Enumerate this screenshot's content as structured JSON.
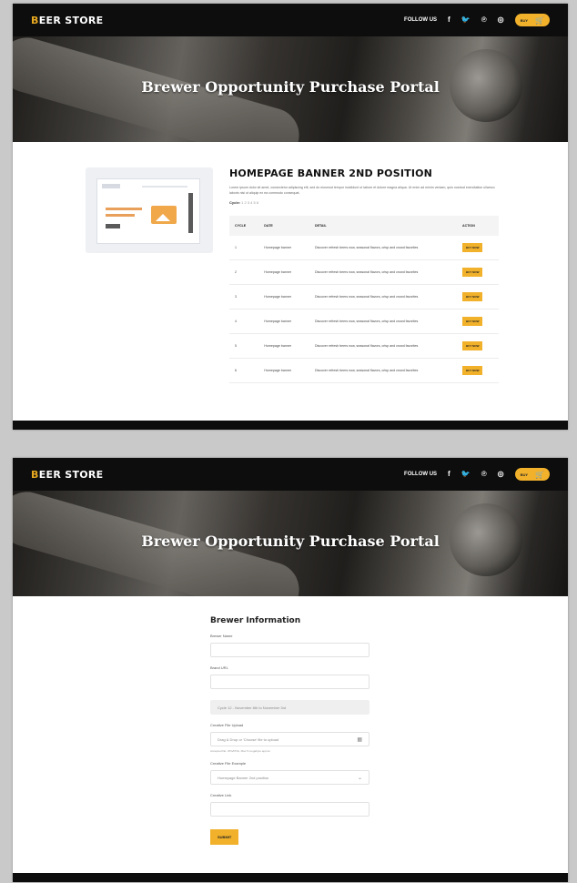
{
  "brand": {
    "prefix": "B",
    "rest": "EER STORE"
  },
  "nav": {
    "follow_label": "FOLLOW US",
    "social": [
      {
        "icon": "facebook-icon",
        "glyph": "f"
      },
      {
        "icon": "twitter-icon",
        "glyph": "🐦"
      },
      {
        "icon": "pinterest-icon",
        "glyph": "℗"
      },
      {
        "icon": "instagram-icon",
        "glyph": "◎"
      }
    ],
    "cart_label": "BUY",
    "cart_icon": "cart-icon"
  },
  "hero": {
    "title": "Brewer Opportunity Purchase Portal"
  },
  "opportunity": {
    "title": "HOMEPAGE BANNER 2ND POSITION",
    "description": "Lorem ipsum dolor sit amet, consectetur adipiscing elit, sed do eiusmod tempor incididunt ut labore et dolore magna aliqua. Ut enim ad minim veniam, quis nostrud exercitation ullamco laboris nisi ut aliquip ex ea commodo consequat.",
    "cycle_label": "Cycle:",
    "cycle_numbers": "1 2 3 4 5 6",
    "table": {
      "headers": [
        "CYCLE",
        "DATE",
        "DETAIL",
        "ACTION"
      ],
      "rows": [
        {
          "cycle": "1",
          "date": "Homepage banner",
          "detail": "Discover refresh beers now, seasonal flavors, crisp and crowd favorites",
          "action": "BUY NOW"
        },
        {
          "cycle": "2",
          "date": "Homepage banner",
          "detail": "Discover refresh beers now, seasonal flavors, crisp and crowd favorites",
          "action": "BUY NOW"
        },
        {
          "cycle": "3",
          "date": "Homepage banner",
          "detail": "Discover refresh beers now, seasonal flavors, crisp and crowd favorites",
          "action": "BUY NOW"
        },
        {
          "cycle": "4",
          "date": "Homepage banner",
          "detail": "Discover refresh beers now, seasonal flavors, crisp and crowd favorites",
          "action": "BUY NOW"
        },
        {
          "cycle": "5",
          "date": "Homepage banner",
          "detail": "Discover refresh beers now, seasonal flavors, crisp and crowd favorites",
          "action": "BUY NOW"
        },
        {
          "cycle": "6",
          "date": "Homepage banner",
          "detail": "Discover refresh beers now, seasonal flavors, crisp and crowd favorites",
          "action": "BUY NOW"
        }
      ]
    }
  },
  "form": {
    "title": "Brewer Information",
    "fields": {
      "brewer_name": {
        "label": "Brewer Name",
        "value": ""
      },
      "brand_url": {
        "label": "Brand URL",
        "value": ""
      },
      "cycle": {
        "value": "Cycle 12 - November 8th to November 3rd"
      },
      "creative_upload": {
        "label": "Creative File Upload",
        "placeholder": "Drag & Drop or 'Choose' file to upload",
        "hint": "Accepted file: JPG/PNG, Max 5 megabyte approx",
        "icon": "upload-icon"
      },
      "creative_example": {
        "label": "Creative File Example",
        "value": "Homepage Banner 2nd position",
        "icon": "chevron-down-icon"
      },
      "creative_link": {
        "label": "Creative Link",
        "value": ""
      }
    },
    "submit_label": "SUBMIT"
  },
  "colors": {
    "accent": "#f1b12b",
    "nav_bg": "#0d0d0d"
  }
}
